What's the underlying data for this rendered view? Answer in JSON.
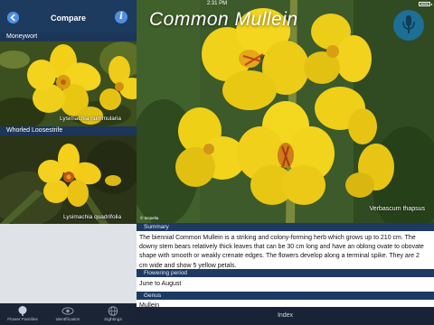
{
  "status": {
    "time": "2:31 PM"
  },
  "navbar": {
    "title": "Compare",
    "back_icon": "back-circle-icon",
    "info_glyph": "i"
  },
  "compare_items": [
    {
      "header": "Moneywort",
      "caption": "Lysimachia nummularia"
    },
    {
      "header": "Whorled Loosestrife",
      "caption": "Lysimachia quadrifolia"
    }
  ],
  "tabs": [
    {
      "label": "Flower Families",
      "icon": "tree-icon"
    },
    {
      "label": "Identification",
      "icon": "eye-icon"
    },
    {
      "label": "Sightings",
      "icon": "globe-icon"
    }
  ],
  "detail": {
    "title": "Common Mullein",
    "latin": "Verbascum thapsus",
    "credit": "© tespelta",
    "mic_icon": "microphone-icon",
    "summary_header": "Summary",
    "summary_text": "The biennial Common Mullein is a striking and colony-forming herb which grows up to 210 cm. The downy stem bears relatively thick leaves that can be 30 cm long and have an oblong ovate to obovate shape with smooth or weakly crenate edges. The flowers develop along a terminal spike. They are 2 cm wide and show 5 yellow petals.",
    "flowering_header": "Flowering period",
    "flowering_text": "June to August",
    "genus_header": "Genus",
    "genus_text": "Mullein",
    "index_label": "Index"
  }
}
